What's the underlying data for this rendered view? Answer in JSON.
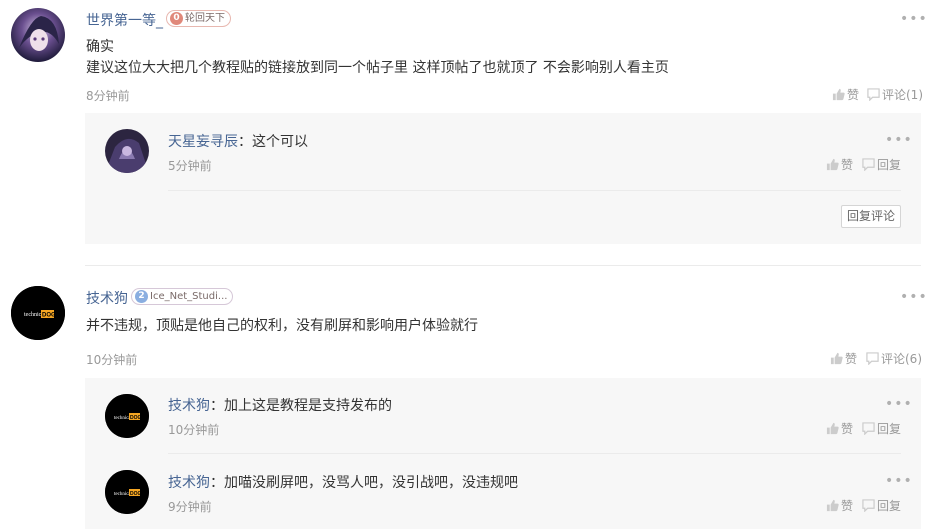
{
  "comments": [
    {
      "user": "世界第一等_",
      "badge_level": "0",
      "badge_text": "轮回天下",
      "lines": [
        "确实",
        "建议这位大大把几个教程贴的链接放到同一个帖子里 这样顶帖了也就顶了 不会影响别人看主页"
      ],
      "time": "8分钟前",
      "like_label": "赞",
      "comment_label": "评论(1)",
      "replies": [
        {
          "user": "天星妄寻辰",
          "colon": "：",
          "text": "这个可以",
          "time": "5分钟前",
          "like_label": "赞",
          "reply_label": "回复"
        }
      ],
      "reply_comment_button": "回复评论"
    },
    {
      "user": "技术狗",
      "badge_level": "2",
      "badge_text": "Ice_Net_Studi...",
      "lines": [
        "并不违规，顶贴是他自己的权利，没有刷屏和影响用户体验就行"
      ],
      "time": "10分钟前",
      "like_label": "赞",
      "comment_label": "评论(6)",
      "replies": [
        {
          "user": "技术狗",
          "colon": "：",
          "text": "加上这是教程是支持发布的",
          "time": "10分钟前",
          "like_label": "赞",
          "reply_label": "回复"
        },
        {
          "user": "技术狗",
          "colon": "：",
          "text": "加喵没刷屏吧，没骂人吧，没引战吧，没违规吧",
          "time": "9分钟前",
          "like_label": "赞",
          "reply_label": "回复"
        }
      ]
    }
  ],
  "avatar_logo_text": [
    "technical",
    "DOG"
  ],
  "colors": {
    "username": "#476593",
    "badge0": "#e0887a",
    "badge2": "#8aaee0",
    "dog_accent": "#f5a623"
  }
}
